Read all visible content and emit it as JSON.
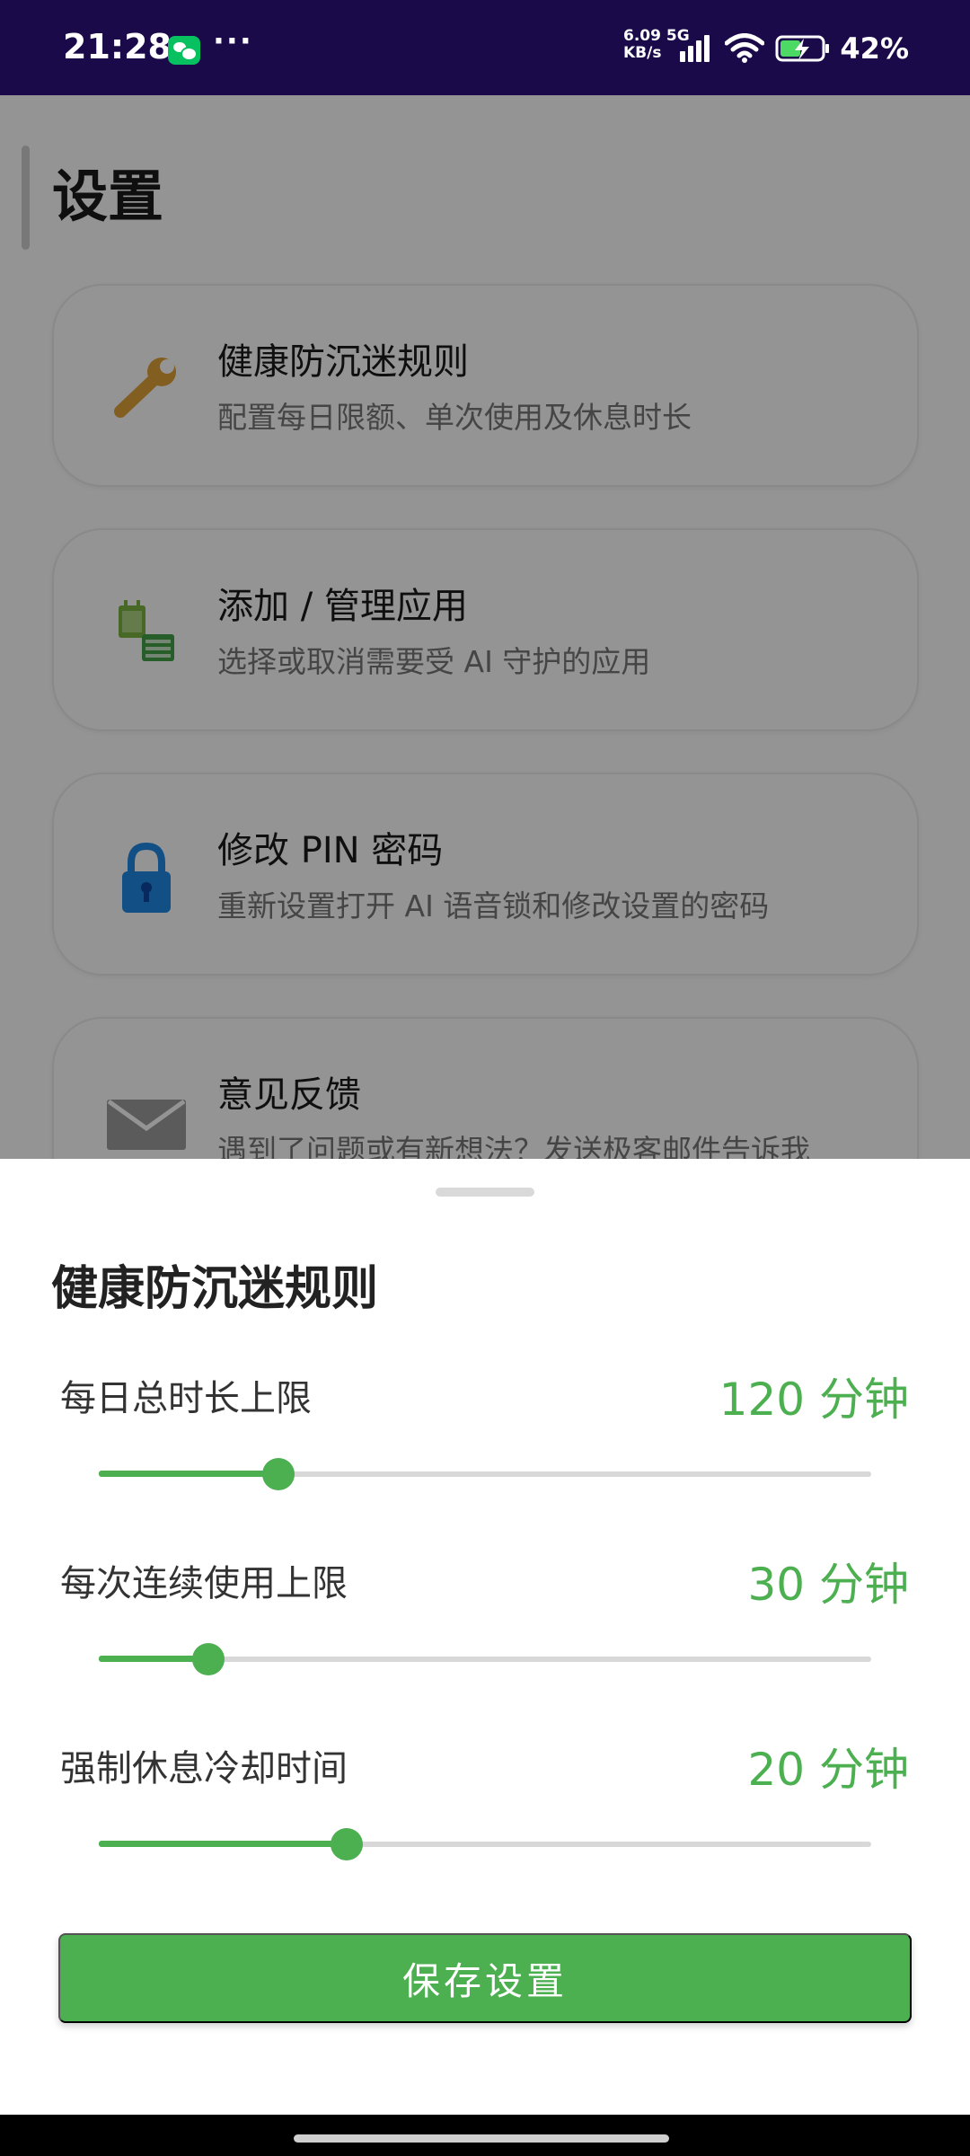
{
  "status_bar": {
    "time": "21:28",
    "net_speed_value": "6.09",
    "net_speed_unit": "KB/s",
    "network_type": "5G",
    "battery_percent": "42%",
    "more_indicator": "···",
    "icons": [
      "wechat-notification-icon",
      "more-dots-icon",
      "signal-icon",
      "wifi-icon",
      "battery-charging-icon"
    ]
  },
  "page": {
    "title": "设置",
    "cards": [
      {
        "title": "健康防沉迷规则",
        "subtitle": "配置每日限额、单次使用及休息时长",
        "icon": "wrench-icon"
      },
      {
        "title": "添加 / 管理应用",
        "subtitle": "选择或取消需要受 AI 守护的应用",
        "icon": "apps-icon"
      },
      {
        "title": "修改 PIN 密码",
        "subtitle": "重新设置打开 AI 语音锁和修改设置的密码",
        "icon": "lock-icon"
      },
      {
        "title": "意见反馈",
        "subtitle": "遇到了问题或有新想法？发送极客邮件告诉我",
        "icon": "mail-icon"
      }
    ]
  },
  "sheet": {
    "title": "健康防沉迷规则",
    "settings": [
      {
        "label": "每日总时长上限",
        "value": "120 分钟",
        "fraction": 0.233
      },
      {
        "label": "每次连续使用上限",
        "value": "30 分钟",
        "fraction": 0.142
      },
      {
        "label": "强制休息冷却时间",
        "value": "20 分钟",
        "fraction": 0.321
      }
    ],
    "save_label": "保存设置",
    "accent_color": "#4caf50"
  }
}
